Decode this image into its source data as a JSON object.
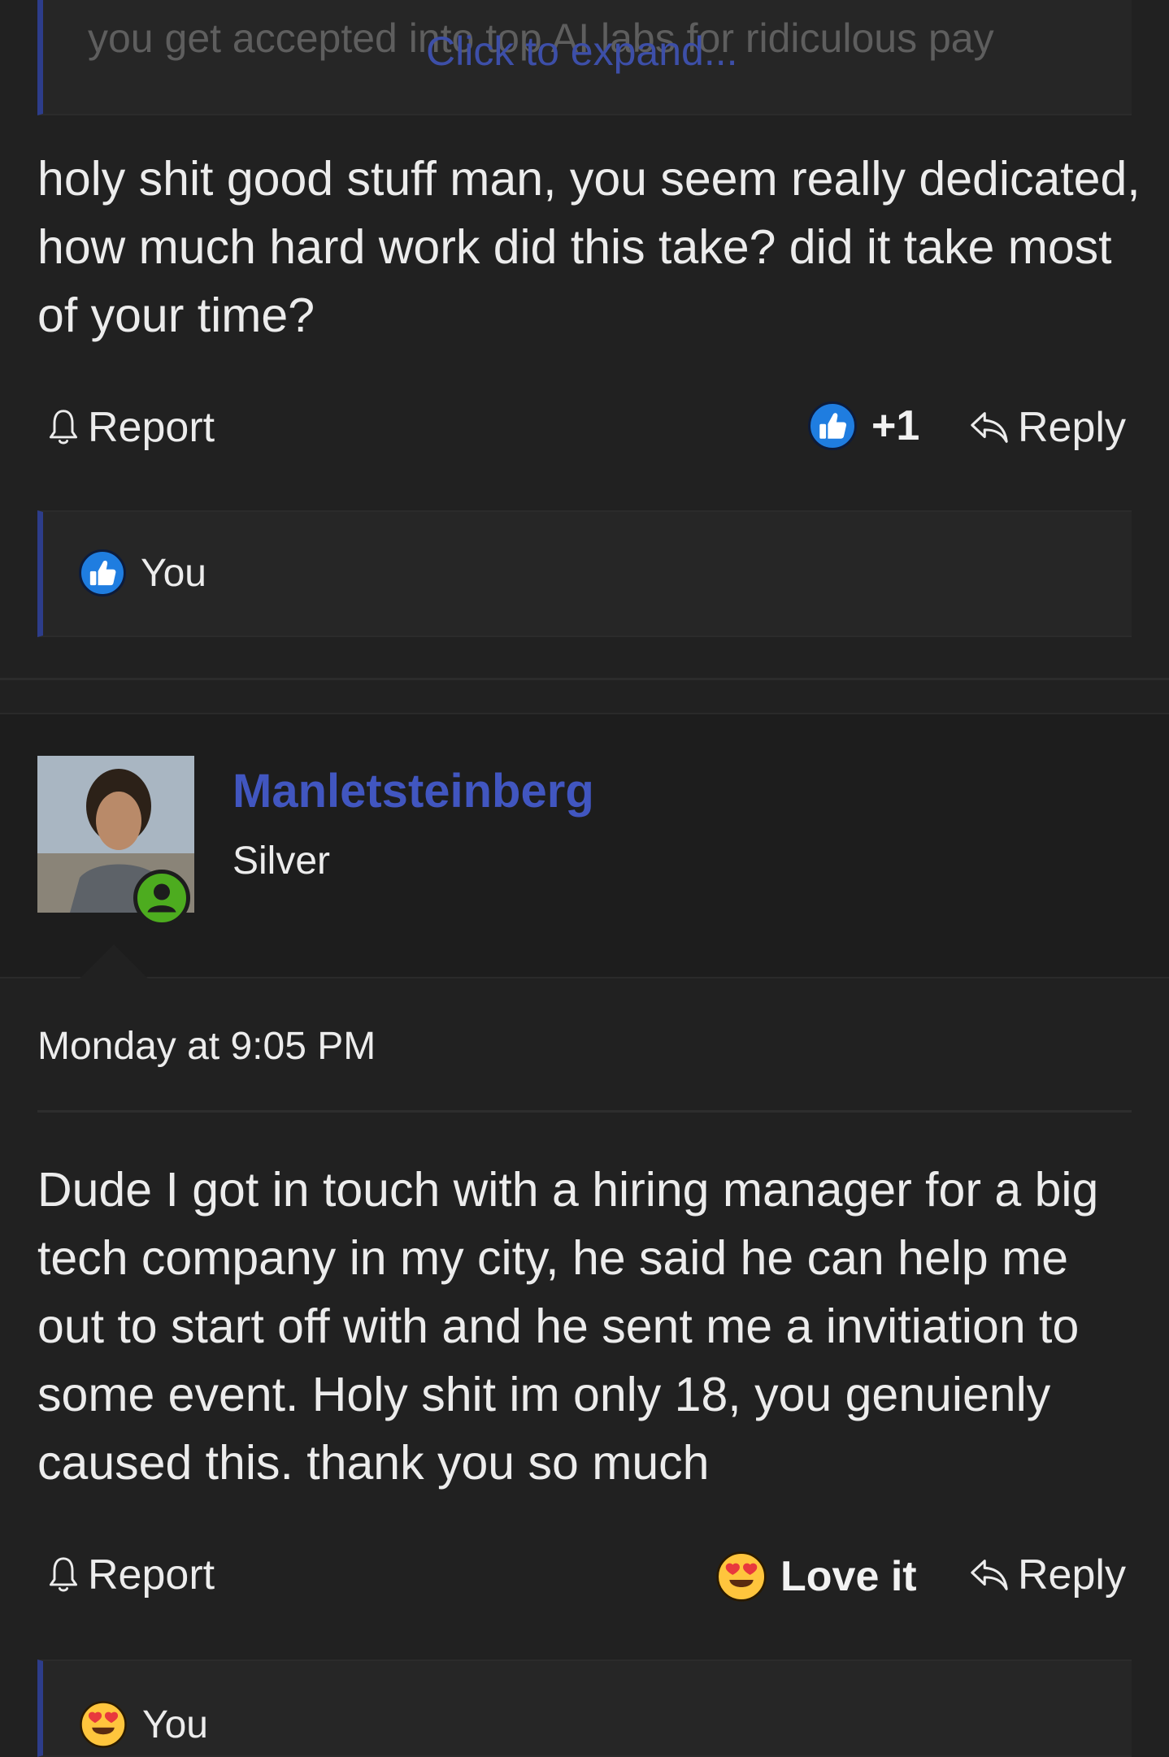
{
  "quoted_post": {
    "faded_text": "you get accepted into top AI labs for ridiculous pay",
    "expand_label": "Click to expand..."
  },
  "post1": {
    "body": "holy shit good stuff man, you seem really dedicated, how much hard work did this take? did it take most of your time?",
    "report_label": "Report",
    "reaction_count": "+1",
    "reply_label": "Reply",
    "reacted_by": "You"
  },
  "post2": {
    "author": "Manletsteinberg",
    "rank": "Silver",
    "timestamp": "Monday at 9:05 PM",
    "body": "Dude I got in touch with a hiring manager for a big tech company in my city, he said he can help me out to start off with and he sent me a invitiation to some event. Holy shit im only 18, you genuienly caused this. thank you so much",
    "report_label": "Report",
    "reaction_label": "Love it",
    "reply_label": "Reply",
    "reacted_by": "You"
  },
  "icons": {
    "report": "bell-icon",
    "reply": "reply-arrow-icon",
    "like": "thumbs-up-icon",
    "love": "heart-eyes-icon",
    "online": "user-online-icon"
  },
  "colors": {
    "background": "#212121",
    "accent": "#4156c0",
    "like": "#1f7de0",
    "love": "#ffc53d",
    "online": "#4dac1f"
  }
}
